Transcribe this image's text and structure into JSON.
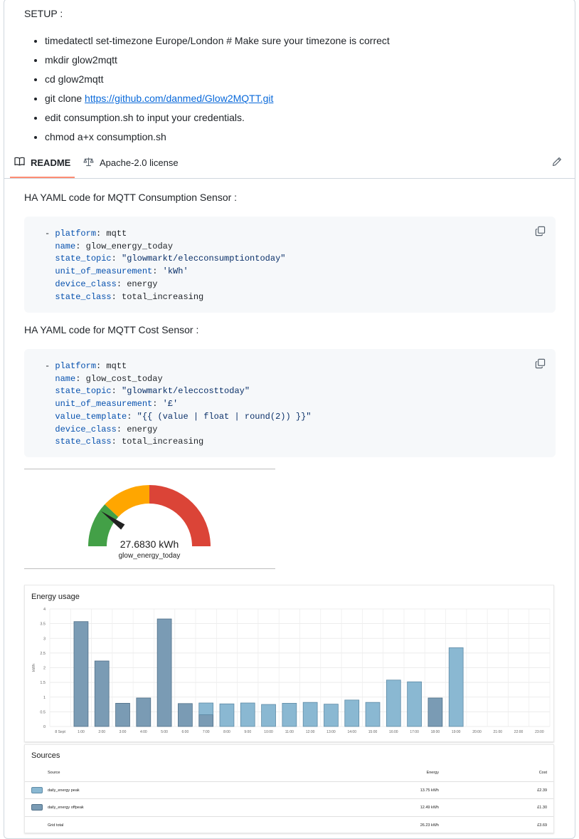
{
  "setup": {
    "title": "SETUP :",
    "steps": [
      "timedatectl set-timezone Europe/London # Make sure your timezone is correct",
      "mkdir glow2mqtt",
      "cd glow2mqtt",
      "git clone ",
      "edit consumption.sh to input your credentials.",
      "chmod a+x consumption.sh"
    ],
    "git_link": "https://github.com/danmed/Glow2MQTT.git"
  },
  "tabs": {
    "readme": "README",
    "license": "Apache-2.0 license"
  },
  "icons": {
    "readme": "book-icon",
    "license": "scale-icon",
    "edit": "pencil-icon",
    "copy": "copy-icon"
  },
  "sections": {
    "consumption_heading": "HA YAML code for MQTT Consumption Sensor :",
    "cost_heading": "HA YAML code for MQTT Cost Sensor :"
  },
  "consumption_yaml": [
    {
      "prefix": "- ",
      "key": "platform",
      "value": "mqtt",
      "quoted": false
    },
    {
      "prefix": "  ",
      "key": "name",
      "value": "glow_energy_today",
      "quoted": false
    },
    {
      "prefix": "  ",
      "key": "state_topic",
      "value": "\"glowmarkt/elecconsumptiontoday\"",
      "quoted": true
    },
    {
      "prefix": "  ",
      "key": "unit_of_measurement",
      "value": "'kWh'",
      "quoted": true
    },
    {
      "prefix": "  ",
      "key": "device_class",
      "value": "energy",
      "quoted": false
    },
    {
      "prefix": "  ",
      "key": "state_class",
      "value": "total_increasing",
      "quoted": false
    }
  ],
  "cost_yaml": [
    {
      "prefix": "- ",
      "key": "platform",
      "value": "mqtt",
      "quoted": false
    },
    {
      "prefix": "  ",
      "key": "name",
      "value": "glow_cost_today",
      "quoted": false
    },
    {
      "prefix": "  ",
      "key": "state_topic",
      "value": "\"glowmarkt/eleccosttoday\"",
      "quoted": true
    },
    {
      "prefix": "  ",
      "key": "unit_of_measurement",
      "value": "'£'",
      "quoted": true
    },
    {
      "prefix": "  ",
      "key": "value_template",
      "value": "\"{{ (value | float | round(2)) }}\"",
      "quoted": true
    },
    {
      "prefix": "  ",
      "key": "device_class",
      "value": "energy",
      "quoted": false
    },
    {
      "prefix": "  ",
      "key": "state_class",
      "value": "total_increasing",
      "quoted": false
    }
  ],
  "gauge": {
    "value_text": "27.6830 kWh",
    "entity": "glow_energy_today",
    "needle_fraction": 0.2,
    "colors": {
      "green": "#43a047",
      "yellow": "#ffa600",
      "red": "#db4437"
    }
  },
  "chart_data": {
    "type": "bar",
    "title": "Energy usage",
    "ylabel": "kWh",
    "ylim": [
      0,
      4
    ],
    "yticks": [
      "0",
      "0.5",
      "1",
      "1.5",
      "2",
      "2.5",
      "3",
      "3.5",
      "4"
    ],
    "categories": [
      "8 Sept",
      "1:00",
      "2:00",
      "3:00",
      "4:00",
      "5:00",
      "6:00",
      "7:00",
      "8:00",
      "9:00",
      "10:00",
      "11:00",
      "12:00",
      "13:00",
      "14:00",
      "15:00",
      "16:00",
      "17:00",
      "18:00",
      "19:00",
      "20:00",
      "21:00",
      "22:00",
      "23:00"
    ],
    "grid": true,
    "series": [
      {
        "name": "daily_energy peak",
        "color": "#8ab8d2",
        "values": [
          0,
          0,
          0,
          0,
          0,
          0,
          0,
          0.4,
          0.77,
          0.8,
          0.75,
          0.79,
          0.82,
          0.76,
          0.9,
          0.82,
          1.58,
          1.52,
          0,
          2.68,
          0,
          0,
          0,
          0
        ]
      },
      {
        "name": "daily_energy offpeak",
        "color": "#7a9bb4",
        "values": [
          0,
          3.57,
          2.23,
          0.79,
          0.97,
          3.66,
          0.78,
          0.4,
          0,
          0,
          0,
          0,
          0,
          0,
          0,
          0,
          0,
          0,
          0.97,
          0,
          0,
          0,
          0,
          0
        ]
      }
    ]
  },
  "sources": {
    "title": "Sources",
    "headers": {
      "source": "Source",
      "energy": "Energy",
      "cost": "Cost"
    },
    "rows": [
      {
        "name": "daily_energy peak",
        "energy": "13.75 kWh",
        "cost": "£2.39",
        "color": "#8ab8d2"
      },
      {
        "name": "daily_energy offpeak",
        "energy": "12.49 kWh",
        "cost": "£1.30",
        "color": "#7a9bb4"
      }
    ],
    "total": {
      "name": "Grid total",
      "energy": "26.23 kWh",
      "cost": "£3.69"
    }
  }
}
